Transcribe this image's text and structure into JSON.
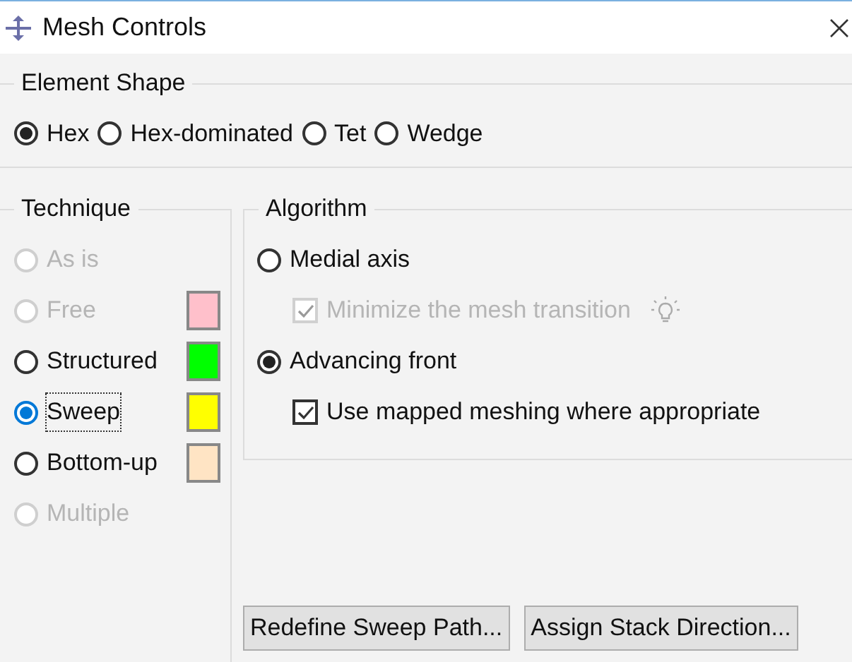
{
  "window": {
    "title": "Mesh Controls"
  },
  "element_shape": {
    "label": "Element Shape",
    "options": [
      {
        "label": "Hex",
        "selected": true
      },
      {
        "label": "Hex-dominated",
        "selected": false
      },
      {
        "label": "Tet",
        "selected": false
      },
      {
        "label": "Wedge",
        "selected": false
      }
    ]
  },
  "technique": {
    "label": "Technique",
    "options": [
      {
        "label": "As is",
        "selected": false,
        "disabled": true,
        "focused": false
      },
      {
        "label": "Free",
        "selected": false,
        "disabled": true,
        "focused": false,
        "color": "#ffc0cb"
      },
      {
        "label": "Structured",
        "selected": false,
        "disabled": false,
        "focused": false,
        "color": "#00ff00"
      },
      {
        "label": "Sweep",
        "selected": true,
        "disabled": false,
        "focused": true,
        "color": "#ffff00"
      },
      {
        "label": "Bottom-up",
        "selected": false,
        "disabled": false,
        "focused": false,
        "color": "#ffe4c4"
      },
      {
        "label": "Multiple",
        "selected": false,
        "disabled": true,
        "focused": false
      }
    ]
  },
  "algorithm": {
    "label": "Algorithm",
    "items": [
      {
        "kind": "radio",
        "label": "Medial axis",
        "selected": false,
        "disabled": false
      },
      {
        "kind": "checkbox",
        "label": "Minimize the mesh transition",
        "checked": true,
        "disabled": true,
        "tip": true
      },
      {
        "kind": "radio",
        "label": "Advancing front",
        "selected": true,
        "disabled": false
      },
      {
        "kind": "checkbox",
        "label": "Use mapped meshing where appropriate",
        "checked": true,
        "disabled": false,
        "tip": false
      }
    ]
  },
  "buttons": [
    "Redefine Sweep Path...",
    "Assign Stack Direction..."
  ]
}
